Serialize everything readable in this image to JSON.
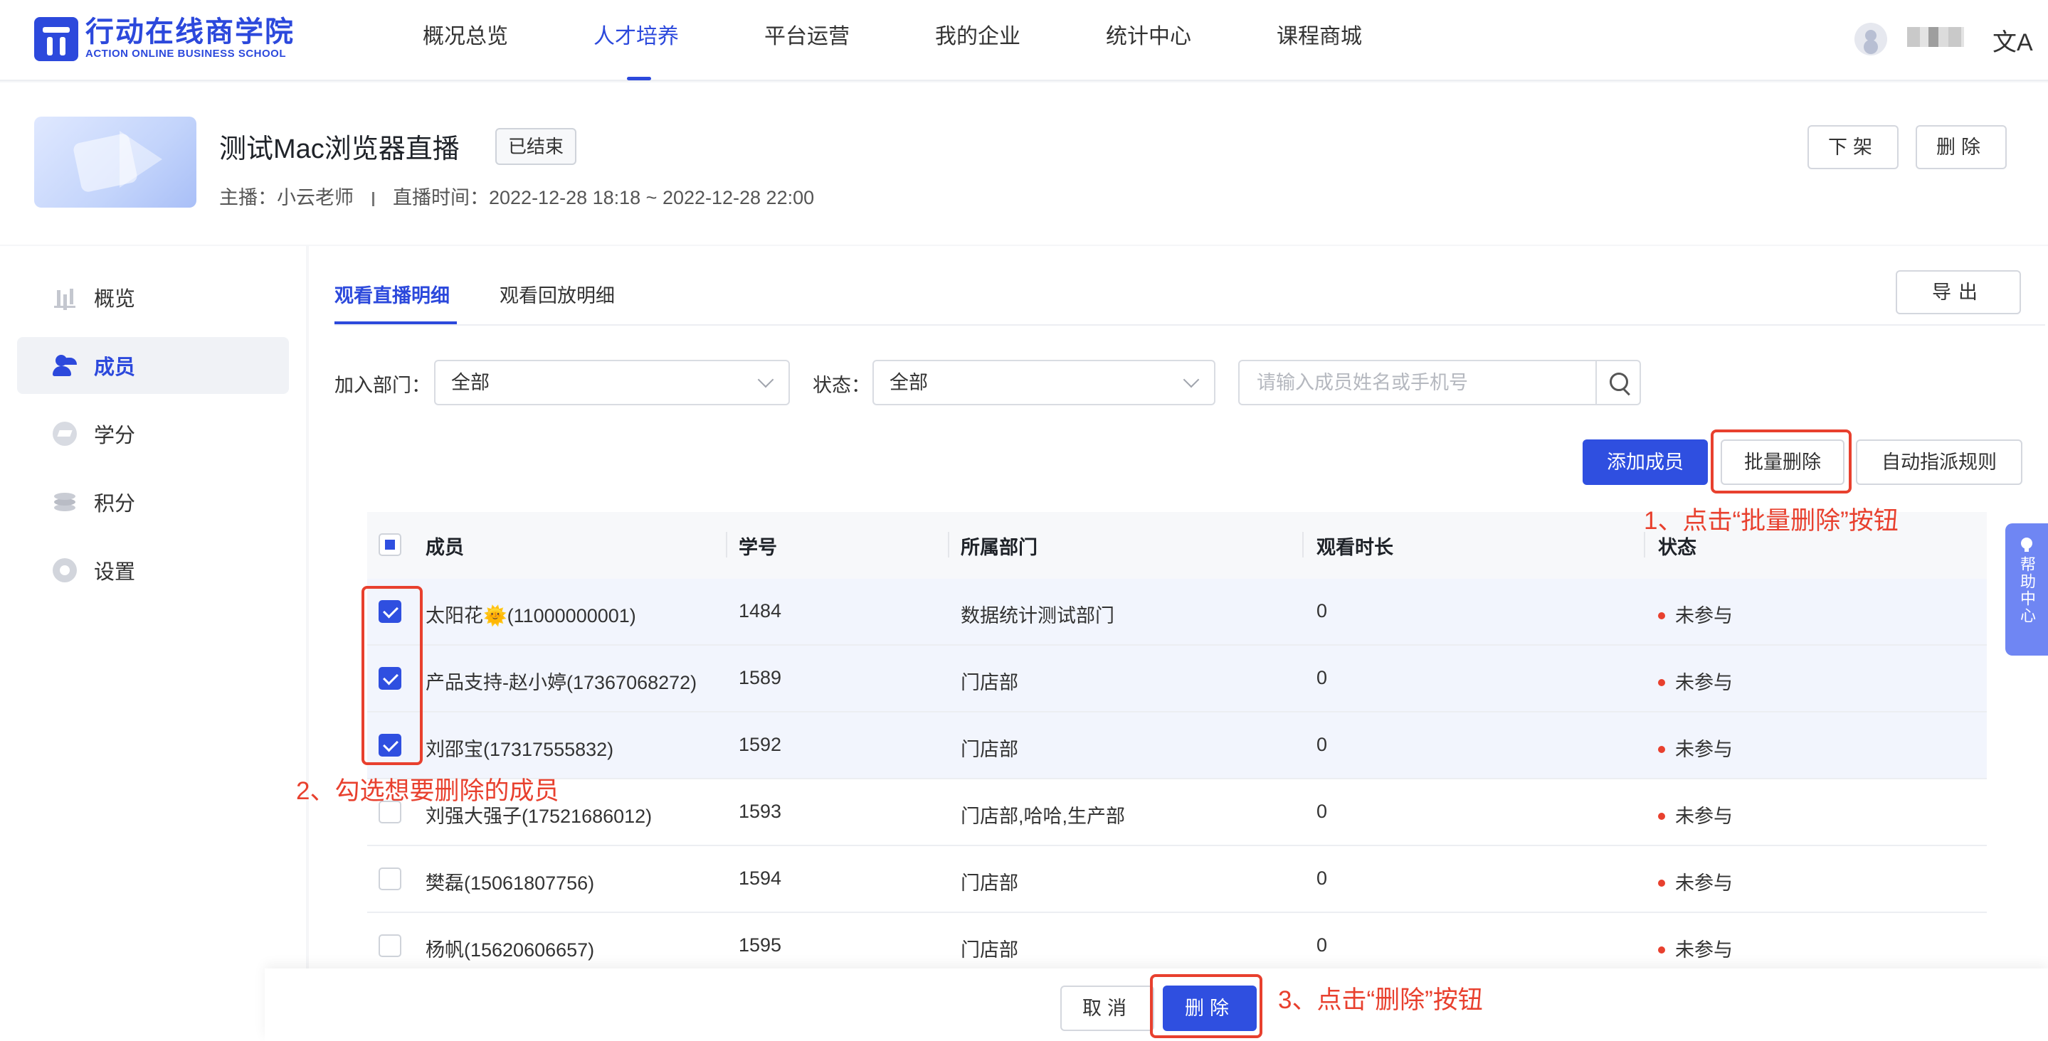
{
  "brand": {
    "name_cn": "行动在线商学院",
    "name_en": "ACTION ONLINE BUSINESS SCHOOL"
  },
  "nav": {
    "items": [
      {
        "label": "概况总览",
        "active": false
      },
      {
        "label": "人才培养",
        "active": true
      },
      {
        "label": "平台运营",
        "active": false
      },
      {
        "label": "我的企业",
        "active": false
      },
      {
        "label": "统计中心",
        "active": false
      },
      {
        "label": "课程商城",
        "active": false
      }
    ],
    "lang_icon": "文A"
  },
  "course": {
    "title": "测试Mac浏览器直播",
    "status": "已结束",
    "host_label": "主播：",
    "host": "小云老师",
    "time_label": "直播时间：",
    "time": "2022-12-28 18:18 ~ 2022-12-28 22:00",
    "btn_offline": "下架",
    "btn_delete": "删除"
  },
  "sidebar": {
    "items": [
      {
        "label": "概览",
        "icon": "chart-icon",
        "active": false
      },
      {
        "label": "成员",
        "icon": "users-icon",
        "active": true
      },
      {
        "label": "学分",
        "icon": "graduation-cap-icon",
        "active": false
      },
      {
        "label": "积分",
        "icon": "coins-icon",
        "active": false
      },
      {
        "label": "设置",
        "icon": "gear-icon",
        "active": false
      }
    ]
  },
  "tabs": [
    {
      "label": "观看直播明细",
      "active": true
    },
    {
      "label": "观看回放明细",
      "active": false
    }
  ],
  "export_label": "导出",
  "filters": {
    "dept_label": "加入部门：",
    "dept_value": "全部",
    "status_label": "状态：",
    "status_value": "全部",
    "search_placeholder": "请输入成员姓名或手机号"
  },
  "actions": {
    "add": "添加成员",
    "batch_delete": "批量删除",
    "auto_assign": "自动指派规则"
  },
  "annotations": {
    "step1": "1、点击“批量删除”按钮",
    "step2": "2、勾选想要删除的成员",
    "step3": "3、点击“删除”按钮"
  },
  "table": {
    "headers": [
      "成员",
      "学号",
      "所属部门",
      "观看时长",
      "状态"
    ],
    "rows": [
      {
        "member": "太阳花🌞(11000000001)",
        "id": "1484",
        "dept": "数据统计测试部门",
        "duration": "0",
        "status": "未参与",
        "checked": true
      },
      {
        "member": "产品支持-赵小婷(17367068272)",
        "id": "1589",
        "dept": "门店部",
        "duration": "0",
        "status": "未参与",
        "checked": true
      },
      {
        "member": "刘邵宝(17317555832)",
        "id": "1592",
        "dept": "门店部",
        "duration": "0",
        "status": "未参与",
        "checked": true
      },
      {
        "member": "刘强大强子(17521686012)",
        "id": "1593",
        "dept": "门店部,哈哈,生产部",
        "duration": "0",
        "status": "未参与",
        "checked": false
      },
      {
        "member": "樊磊(15061807756)",
        "id": "1594",
        "dept": "门店部",
        "duration": "0",
        "status": "未参与",
        "checked": false
      },
      {
        "member": "杨帆(15620606657)",
        "id": "1595",
        "dept": "门店部",
        "duration": "0",
        "status": "未参与",
        "checked": false
      }
    ]
  },
  "bottom": {
    "cancel": "取消",
    "delete": "删除"
  },
  "help": {
    "label": "帮助中心"
  },
  "colors": {
    "primary": "#2f4fe0",
    "annotation": "#e8402e",
    "status_dot": "#e8402e"
  }
}
